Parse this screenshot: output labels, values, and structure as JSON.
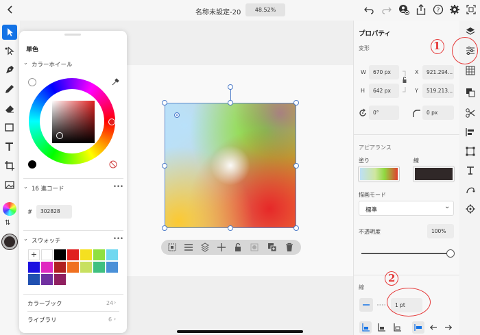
{
  "toolbar": {
    "title": "名称未設定-20",
    "zoom": "48.52%",
    "icons": [
      "back-icon",
      "undo-icon",
      "redo-icon",
      "add-user-icon",
      "share-icon",
      "help-icon",
      "settings-icon",
      "fit-screen-icon"
    ]
  },
  "color_panel": {
    "title": "単色",
    "wheel_section": "カラーホイール",
    "hex_section": "16 進コード",
    "hex_prefix": "#",
    "hex_value": "302828",
    "swatches_section": "スウォッチ",
    "more": "•••",
    "add_swatch": "+",
    "swatches": [
      "#ffffff",
      "#000000",
      "#e02020",
      "#f5e020",
      "#90e040",
      "#70d8f0",
      "#1a10e0",
      "#e028c0",
      "#b02020",
      "#f07020",
      "#c8e060",
      "#40c080",
      "#4a90d8",
      "#2050b0",
      "#7030a0",
      "#902060"
    ],
    "rows": [
      {
        "label": "カラーブック",
        "count": "24"
      },
      {
        "label": "ライブラリ",
        "count": "6"
      }
    ]
  },
  "properties": {
    "title": "プロパティ",
    "transform_label": "変形",
    "w_label": "W",
    "w_value": "670 px",
    "h_label": "H",
    "h_value": "642 px",
    "x_label": "X",
    "x_value": "921.294...",
    "y_label": "Y",
    "y_value": "519.213...",
    "rotation": "0°",
    "corner": "0 px",
    "appearance_label": "アピアランス",
    "fill_label": "塗り",
    "stroke_label": "線",
    "blend_label": "描画モード",
    "blend_value": "標準",
    "opacity_label": "不透明度",
    "opacity_value": "100%",
    "opacity_fraction": 1.0,
    "stroke_section": "線",
    "stroke_width": "1 pt",
    "stroke_color": "#302828"
  },
  "annotations": {
    "one": "1",
    "two": "2",
    "color": "#e53838"
  }
}
